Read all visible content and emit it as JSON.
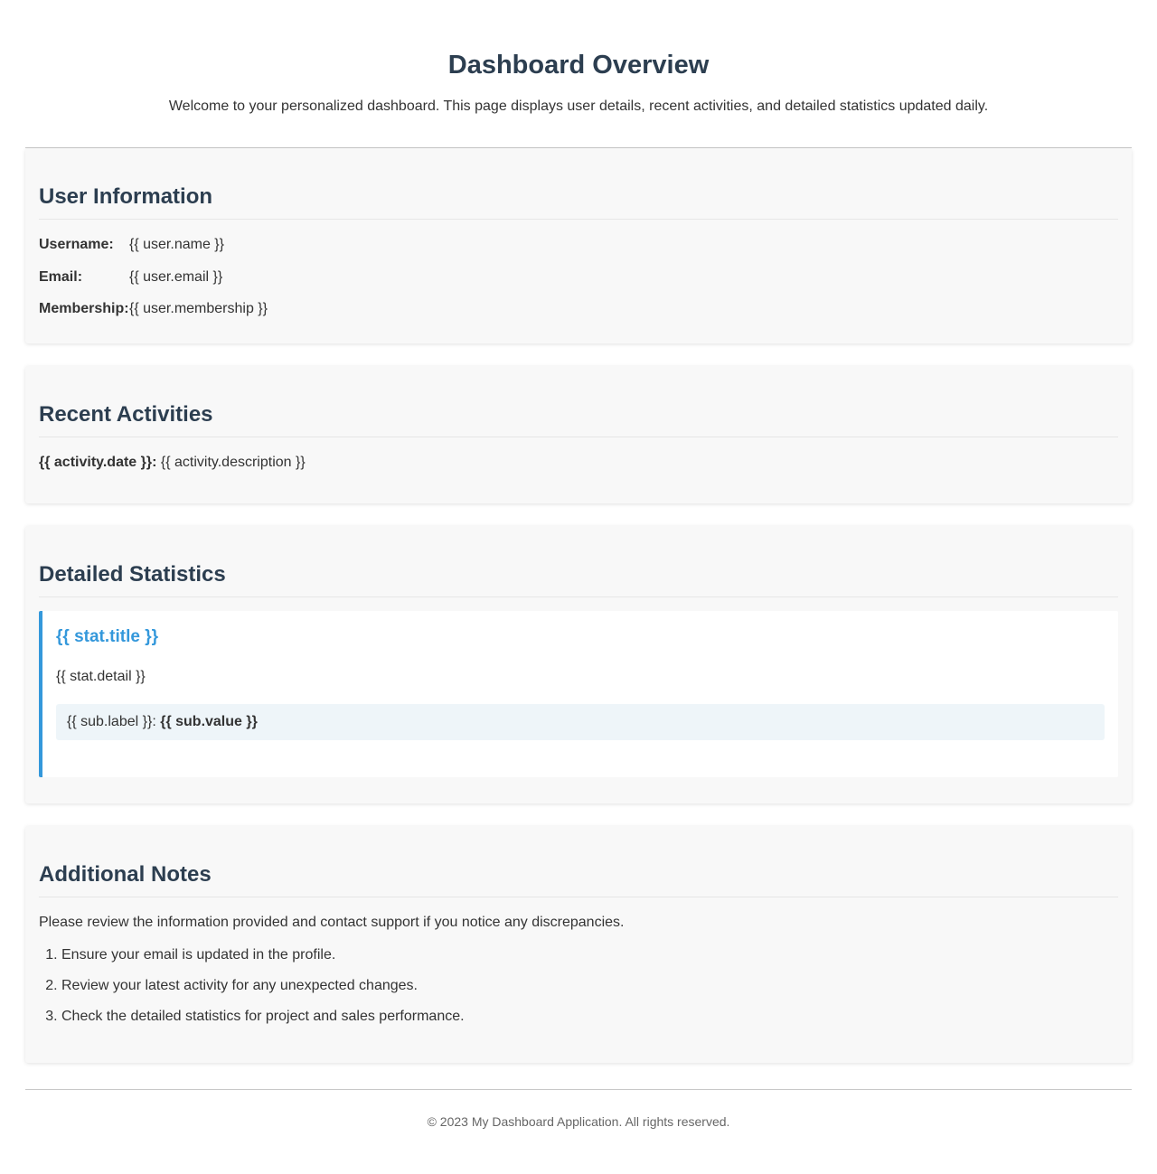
{
  "header": {
    "title": "Dashboard Overview",
    "subtitle": "Welcome to your personalized dashboard. This page displays user details, recent activities, and detailed statistics updated daily."
  },
  "user_info": {
    "heading": "User Information",
    "rows": [
      {
        "label": "Username:",
        "value": "{{ user.name }}"
      },
      {
        "label": "Email:",
        "value": "{{ user.email }}"
      },
      {
        "label": "Membership:",
        "value": "{{ user.membership }}"
      }
    ]
  },
  "activities": {
    "heading": "Recent Activities",
    "items": [
      {
        "date": "{{ activity.date }}:",
        "description": "{{ activity.description }}"
      }
    ]
  },
  "statistics": {
    "heading": "Detailed Statistics",
    "items": [
      {
        "title": "{{ stat.title }}",
        "detail": "{{ stat.detail }}",
        "sub": {
          "label": "{{ sub.label }}:",
          "value": "{{ sub.value }}"
        }
      }
    ]
  },
  "notes": {
    "heading": "Additional Notes",
    "intro": "Please review the information provided and contact support if you notice any discrepancies.",
    "items": [
      "Ensure your email is updated in the profile.",
      "Review your latest activity for any unexpected changes.",
      "Check the detailed statistics for project and sales performance."
    ]
  },
  "footer": {
    "text": "© 2023 My Dashboard Application. All rights reserved."
  },
  "colors": {
    "heading": "#2c3e50",
    "accent": "#3498db",
    "card_bg": "#f8f8f8",
    "sub_bg": "#eef5f9"
  }
}
